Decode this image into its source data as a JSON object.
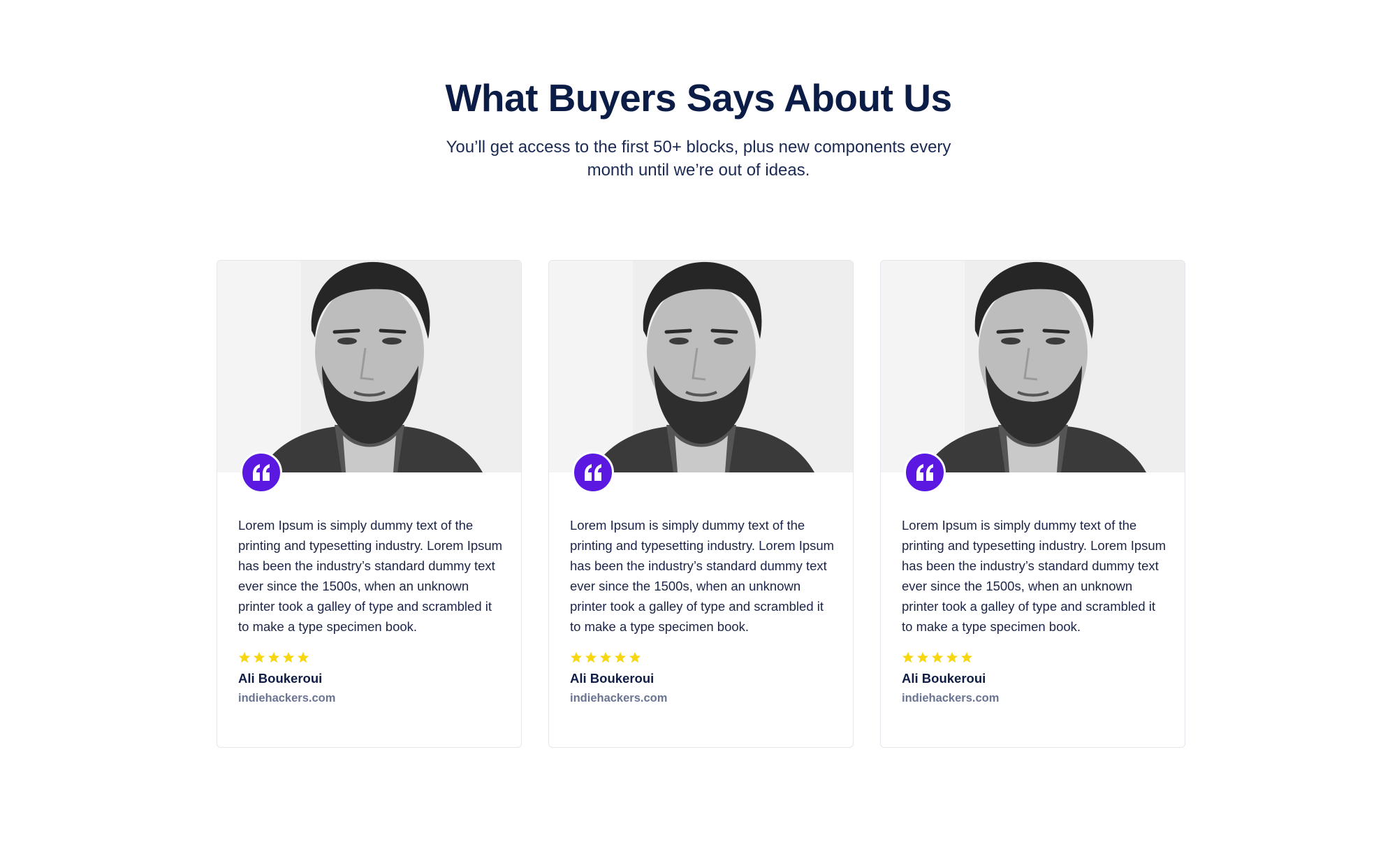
{
  "section": {
    "title": "What Buyers Says About Us",
    "subtitle": "You’ll get access to the first 50+ blocks, plus new components every month until we’re out of ideas."
  },
  "colors": {
    "heading": "#0b1c47",
    "accent": "#5b18e0",
    "star": "#f7d711",
    "muted": "#6b7593"
  },
  "testimonials": [
    {
      "text": "Lorem Ipsum is simply dummy text of the printing and typesetting industry. Lorem Ipsum has been the industry’s standard dummy text ever since the 1500s, when an unknown printer took a galley of type and scrambled it to make a type specimen book.",
      "rating": 5,
      "author": "Ali Boukeroui",
      "site": "indiehackers.com",
      "photo_icon": "portrait-photo",
      "badge_icon": "quote-icon"
    },
    {
      "text": "Lorem Ipsum is simply dummy text of the printing and typesetting industry. Lorem Ipsum has been the industry’s standard dummy text ever since the 1500s, when an unknown printer took a galley of type and scrambled it to make a type specimen book.",
      "rating": 5,
      "author": "Ali Boukeroui",
      "site": "indiehackers.com",
      "photo_icon": "portrait-photo",
      "badge_icon": "quote-icon"
    },
    {
      "text": "Lorem Ipsum is simply dummy text of the printing and typesetting industry. Lorem Ipsum has been the industry’s standard dummy text ever since the 1500s, when an unknown printer took a galley of type and scrambled it to make a type specimen book.",
      "rating": 5,
      "author": "Ali Boukeroui",
      "site": "indiehackers.com",
      "photo_icon": "portrait-photo",
      "badge_icon": "quote-icon"
    }
  ]
}
